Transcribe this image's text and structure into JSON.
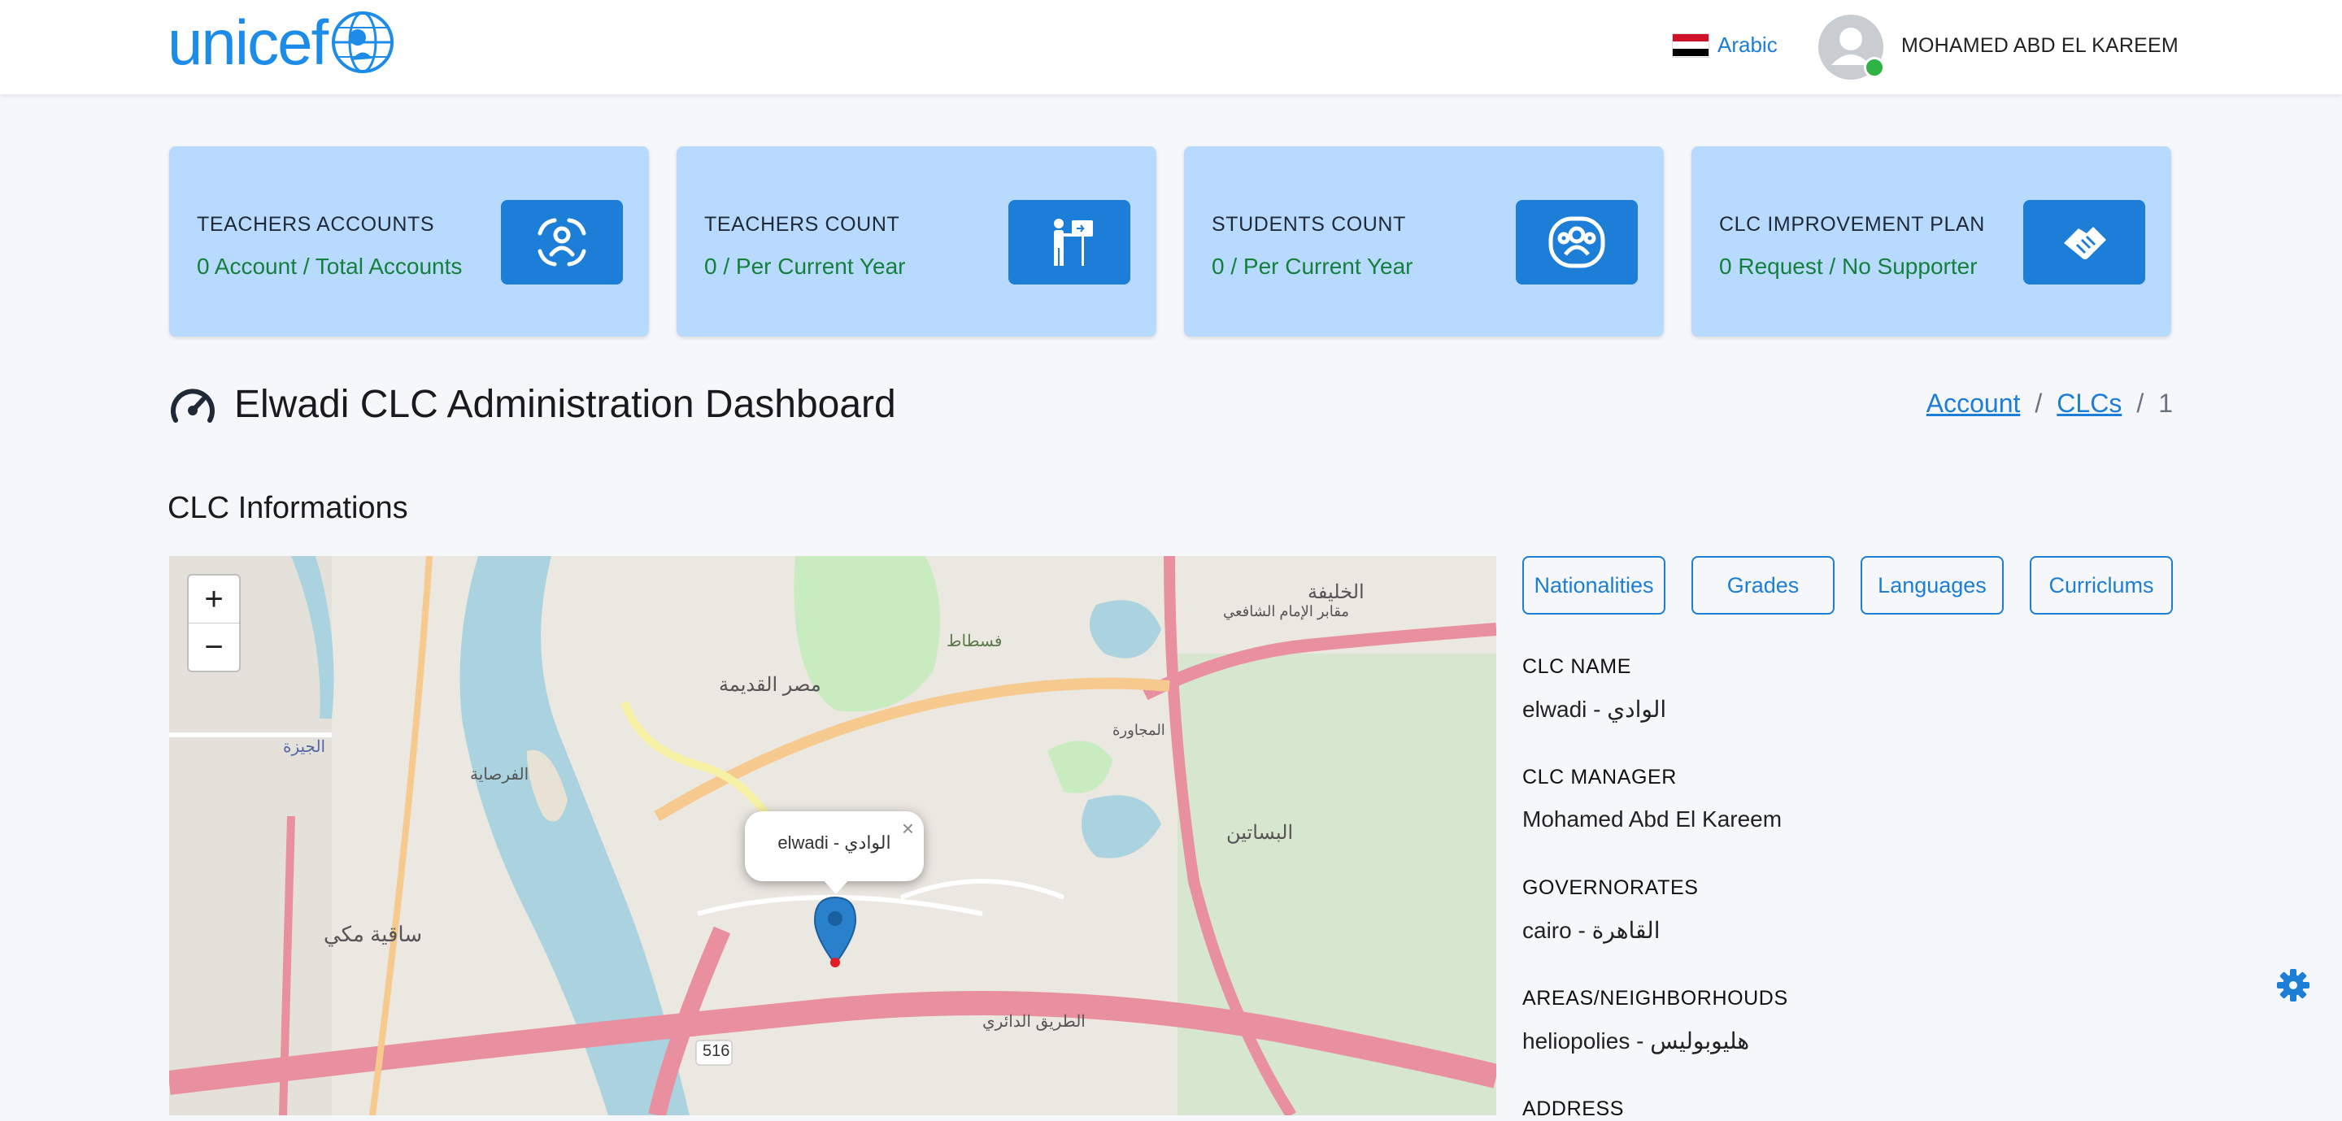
{
  "header": {
    "brand": "unicef",
    "language_label": "Arabic",
    "user_name": "MOHAMED ABD EL KAREEM",
    "flag_colors": [
      "#ce1126",
      "#ffffff",
      "#000000"
    ],
    "online_color": "#2fb344"
  },
  "stats": [
    {
      "title": "TEACHERS ACCOUNTS",
      "value": "0 Account / Total Accounts",
      "icon": "user-scan-icon"
    },
    {
      "title": "TEACHERS COUNT",
      "value": "0 / Per Current Year",
      "icon": "teacher-board-icon"
    },
    {
      "title": "STUDENTS COUNT",
      "value": "0 / Per Current Year",
      "icon": "users-group-icon"
    },
    {
      "title": "CLC IMPROVEMENT PLAN",
      "value": "0 Request / No Supporter",
      "icon": "handshake-icon"
    }
  ],
  "page": {
    "title": "Elwadi CLC Administration Dashboard",
    "breadcrumb": {
      "account": "Account",
      "clcs": "CLCs",
      "current": "1",
      "sep": "/"
    },
    "section_title": "CLC Informations"
  },
  "map": {
    "zoom_in": "+",
    "zoom_out": "−",
    "popup_text": "elwadi - الوادي",
    "popup_close": "×",
    "road_shield": "516",
    "labels": {
      "fustat": "فسطاط",
      "misr_qadima": "مصر القديمة",
      "giza": "الجيزة",
      "fustat_area": "الفرصاية",
      "saqiya_makki": "ساقية مكي",
      "basateen": "البساتين",
      "ring_road": "الطريق الدائري",
      "khalifa": "الخليفة",
      "majawra": "المجاورة",
      "imam_shafei": "مقابر الإمام الشافعي"
    }
  },
  "tabs": [
    "Nationalities",
    "Grades",
    "Languages",
    "Curriclums"
  ],
  "info": [
    {
      "label": "CLC NAME",
      "value": "elwadi - الوادي"
    },
    {
      "label": "CLC MANAGER",
      "value": "Mohamed Abd El Kareem"
    },
    {
      "label": "GOVERNORATES",
      "value": "cairo - القاهرة"
    },
    {
      "label": "AREAS/NEIGHBORHOUDS",
      "value": "heliopolies - هليوبوليس"
    },
    {
      "label": "ADDRESS",
      "value": ""
    }
  ],
  "colors": {
    "accent": "#1c7ed6",
    "card_bg": "#b8daff",
    "value_green": "#15803d"
  }
}
